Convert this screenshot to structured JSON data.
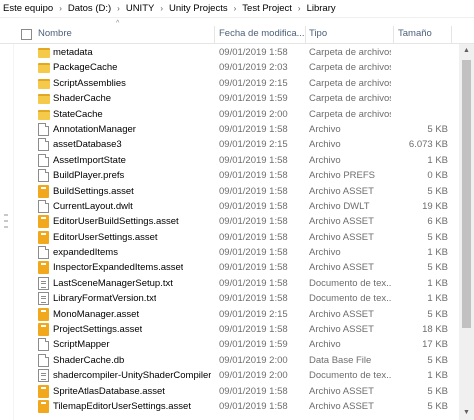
{
  "breadcrumb": {
    "items": [
      "Este equipo",
      "Datos (D:)",
      "UNITY",
      "Unity Projects",
      "Test Project",
      "Library"
    ],
    "separator": "›"
  },
  "columns": {
    "name": "Nombre",
    "date": "Fecha de modifica...",
    "type": "Tipo",
    "size": "Tamaño",
    "sort_indicator": "^"
  },
  "rows": [
    {
      "name": "metadata",
      "date": "09/01/2019 1:58",
      "type": "Carpeta de archivos",
      "size": "",
      "icon": "folder-icon"
    },
    {
      "name": "PackageCache",
      "date": "09/01/2019 2:03",
      "type": "Carpeta de archivos",
      "size": "",
      "icon": "folder-icon"
    },
    {
      "name": "ScriptAssemblies",
      "date": "09/01/2019 2:15",
      "type": "Carpeta de archivos",
      "size": "",
      "icon": "folder-icon"
    },
    {
      "name": "ShaderCache",
      "date": "09/01/2019 1:59",
      "type": "Carpeta de archivos",
      "size": "",
      "icon": "folder-icon"
    },
    {
      "name": "StateCache",
      "date": "09/01/2019 2:00",
      "type": "Carpeta de archivos",
      "size": "",
      "icon": "folder-icon"
    },
    {
      "name": "AnnotationManager",
      "date": "09/01/2019 1:58",
      "type": "Archivo",
      "size": "5 KB",
      "icon": "file-icon"
    },
    {
      "name": "assetDatabase3",
      "date": "09/01/2019 2:15",
      "type": "Archivo",
      "size": "6.073 KB",
      "icon": "file-icon"
    },
    {
      "name": "AssetImportState",
      "date": "09/01/2019 1:58",
      "type": "Archivo",
      "size": "1 KB",
      "icon": "file-icon"
    },
    {
      "name": "BuildPlayer.prefs",
      "date": "09/01/2019 1:58",
      "type": "Archivo PREFS",
      "size": "0 KB",
      "icon": "file-icon"
    },
    {
      "name": "BuildSettings.asset",
      "date": "09/01/2019 1:58",
      "type": "Archivo ASSET",
      "size": "5 KB",
      "icon": "unity-asset-icon"
    },
    {
      "name": "CurrentLayout.dwlt",
      "date": "09/01/2019 1:58",
      "type": "Archivo DWLT",
      "size": "19 KB",
      "icon": "file-icon"
    },
    {
      "name": "EditorUserBuildSettings.asset",
      "date": "09/01/2019 1:58",
      "type": "Archivo ASSET",
      "size": "6 KB",
      "icon": "unity-asset-icon"
    },
    {
      "name": "EditorUserSettings.asset",
      "date": "09/01/2019 1:58",
      "type": "Archivo ASSET",
      "size": "5 KB",
      "icon": "unity-asset-icon"
    },
    {
      "name": "expandedItems",
      "date": "09/01/2019 1:58",
      "type": "Archivo",
      "size": "1 KB",
      "icon": "file-icon"
    },
    {
      "name": "InspectorExpandedItems.asset",
      "date": "09/01/2019 1:58",
      "type": "Archivo ASSET",
      "size": "5 KB",
      "icon": "unity-asset-icon"
    },
    {
      "name": "LastSceneManagerSetup.txt",
      "date": "09/01/2019 1:58",
      "type": "Documento de tex...",
      "size": "1 KB",
      "icon": "text-file-icon"
    },
    {
      "name": "LibraryFormatVersion.txt",
      "date": "09/01/2019 1:58",
      "type": "Documento de tex...",
      "size": "1 KB",
      "icon": "text-file-icon"
    },
    {
      "name": "MonoManager.asset",
      "date": "09/01/2019 2:15",
      "type": "Archivo ASSET",
      "size": "5 KB",
      "icon": "unity-asset-icon"
    },
    {
      "name": "ProjectSettings.asset",
      "date": "09/01/2019 1:58",
      "type": "Archivo ASSET",
      "size": "18 KB",
      "icon": "unity-asset-icon"
    },
    {
      "name": "ScriptMapper",
      "date": "09/01/2019 1:59",
      "type": "Archivo",
      "size": "17 KB",
      "icon": "file-icon"
    },
    {
      "name": "ShaderCache.db",
      "date": "09/01/2019 2:00",
      "type": "Data Base File",
      "size": "5 KB",
      "icon": "file-icon"
    },
    {
      "name": "shadercompiler-UnityShaderCompiler...",
      "date": "09/01/2019 2:00",
      "type": "Documento de tex...",
      "size": "1 KB",
      "icon": "text-file-icon"
    },
    {
      "name": "SpriteAtlasDatabase.asset",
      "date": "09/01/2019 1:58",
      "type": "Archivo ASSET",
      "size": "5 KB",
      "icon": "unity-asset-icon"
    },
    {
      "name": "TilemapEditorUserSettings.asset",
      "date": "09/01/2019 1:58",
      "type": "Archivo ASSET",
      "size": "5 KB",
      "icon": "unity-asset-icon"
    }
  ],
  "colors": {
    "folder": "#f5c94a",
    "unity_asset": "#f2a81d",
    "header_text": "#4c607a",
    "secondary_text": "#6d6d6d"
  }
}
